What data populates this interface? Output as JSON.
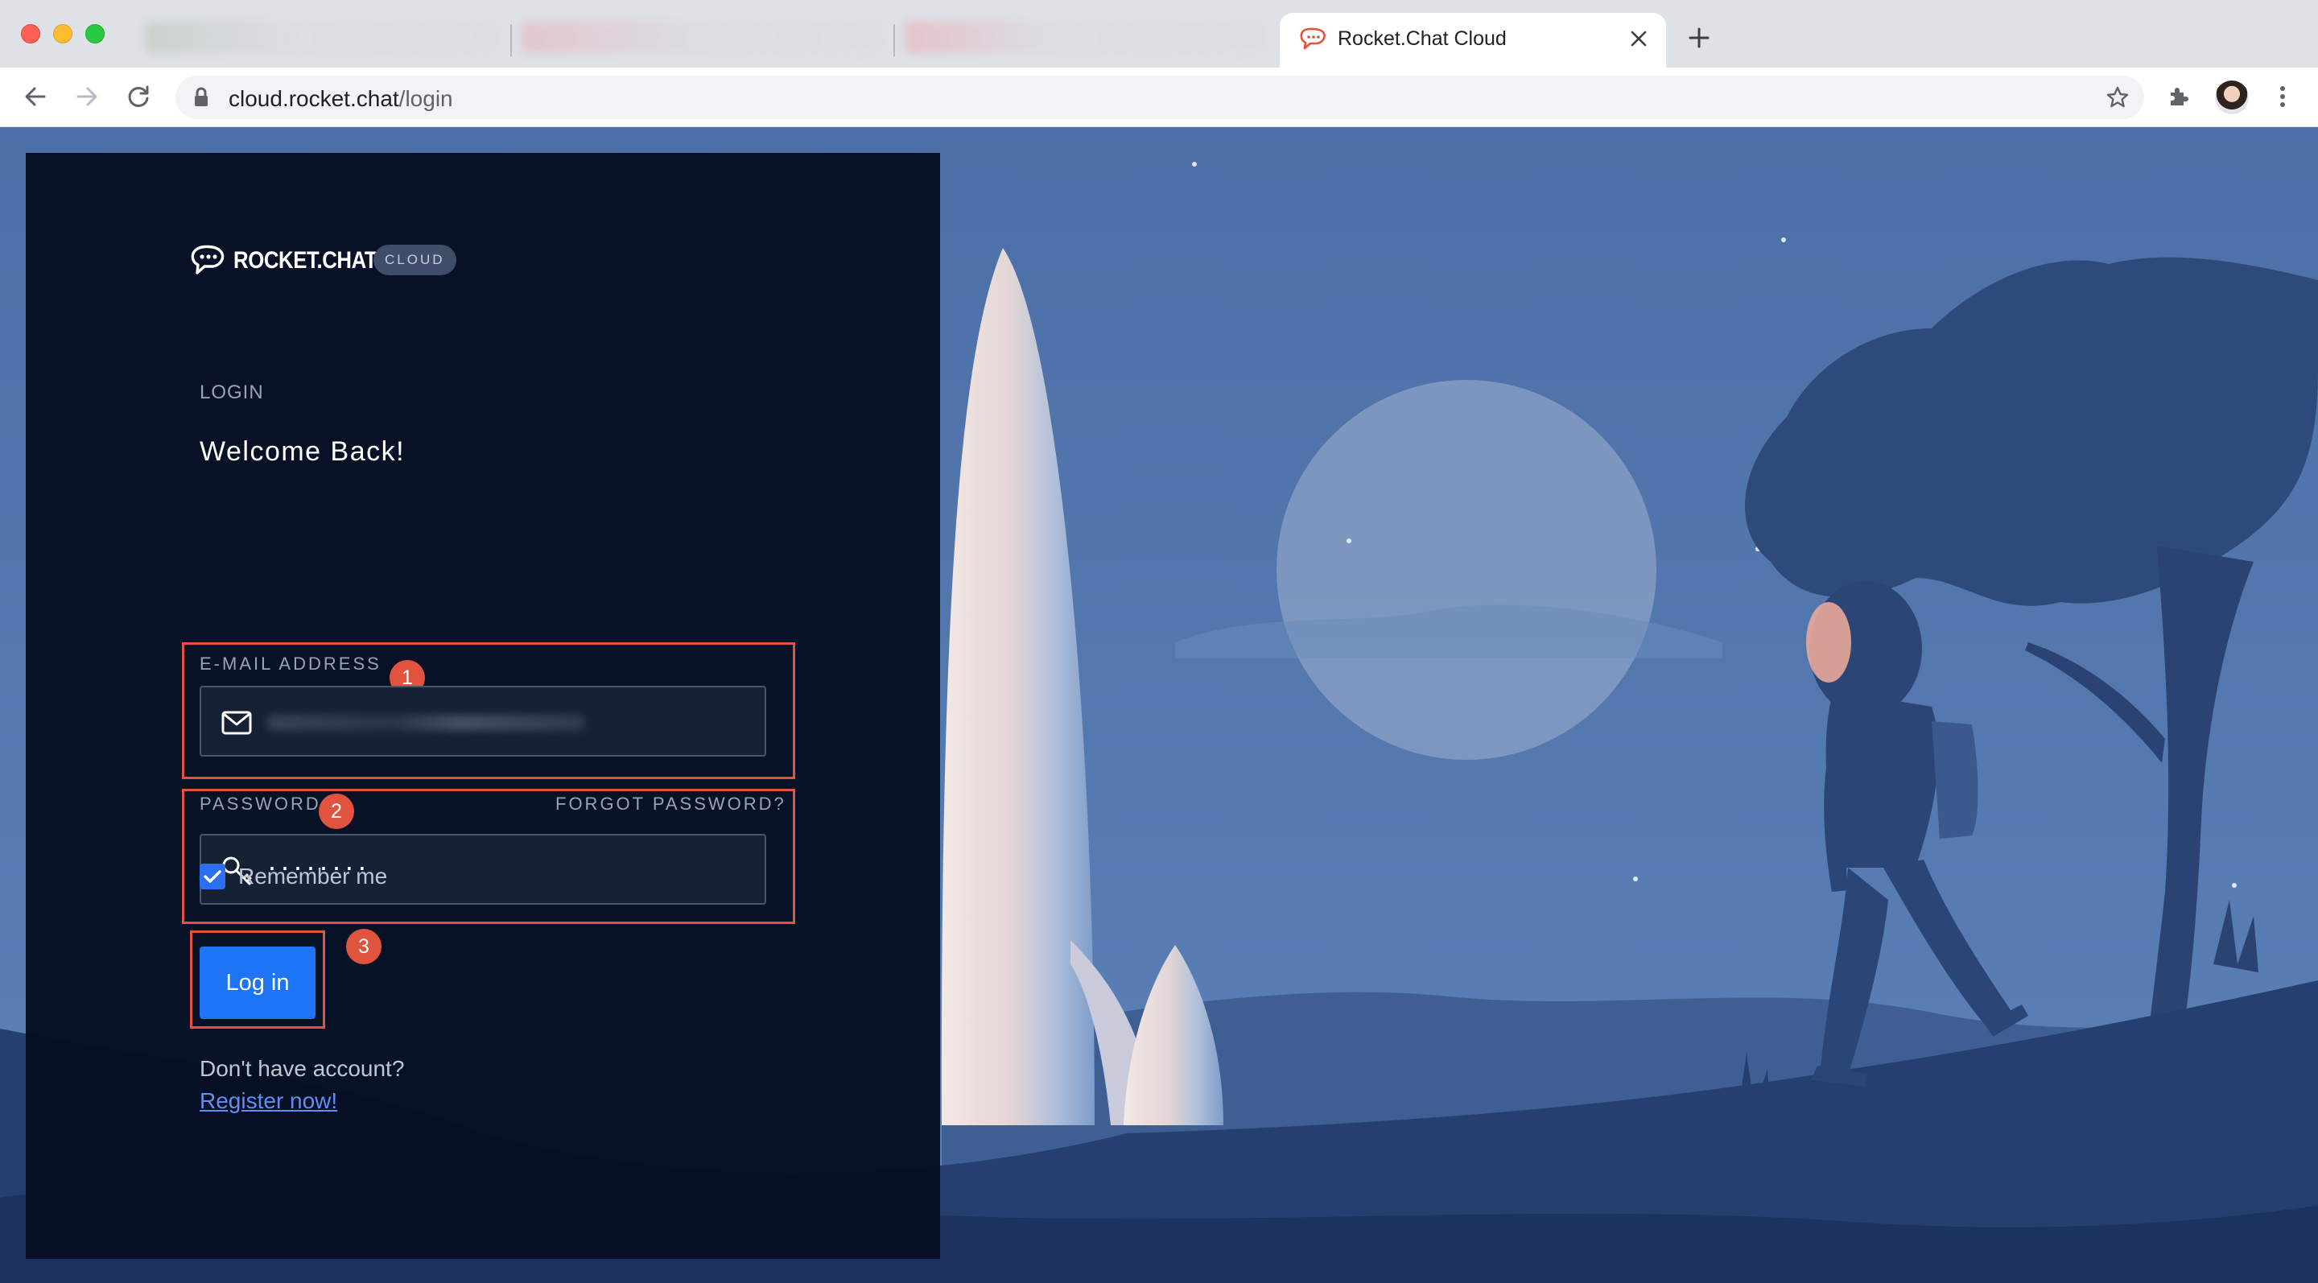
{
  "browser": {
    "tab_title": "Rocket.Chat Cloud",
    "url_domain": "cloud.rocket.chat",
    "url_path": "/login"
  },
  "logo": {
    "text": "ROCKET.CHAT",
    "badge": "CLOUD"
  },
  "login": {
    "section_label": "LOGIN",
    "heading": "Welcome Back!",
    "email_label": "E-MAIL ADDRESS",
    "password_label": "PASSWORD",
    "forgot_password": "FORGOT PASSWORD?",
    "password_value": "········",
    "remember_label": "Remember me",
    "remember_checked": true,
    "submit_label": "Log in",
    "no_account_text": "Don't have account?",
    "register_link": "Register now!"
  },
  "annotations": {
    "step1": "1",
    "step2": "2",
    "step3": "3"
  },
  "colors": {
    "panel_bg": "#050e20",
    "sky_bg": "#4d72a8",
    "accent_button": "#1d74f5",
    "annotation_red": "#e0533f",
    "link": "#5d8ff5"
  }
}
